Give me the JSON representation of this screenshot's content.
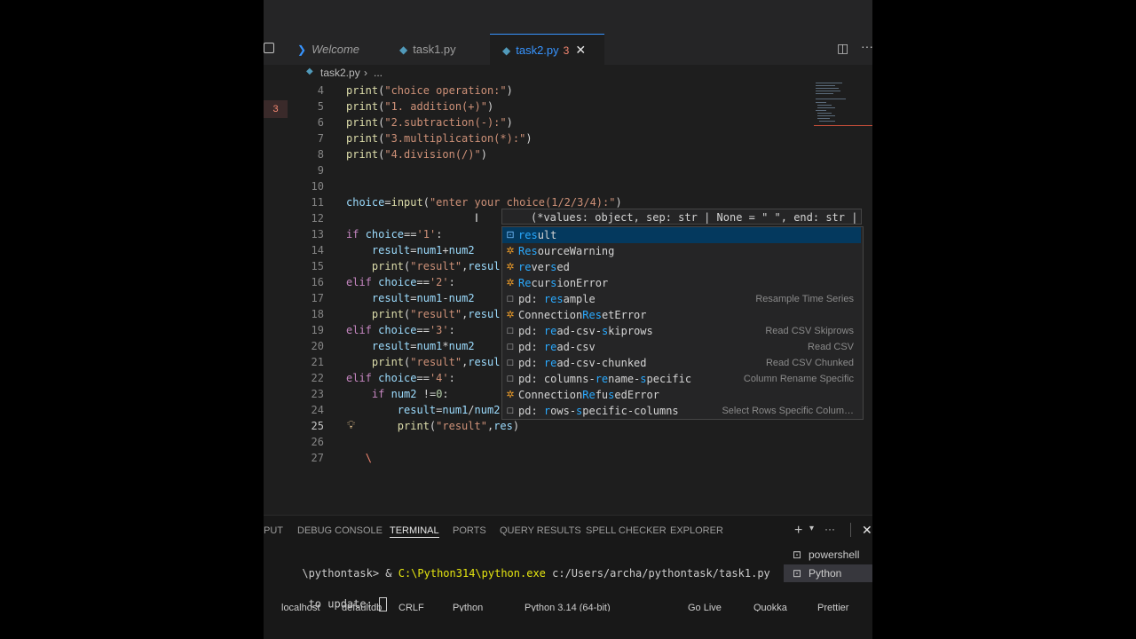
{
  "tabs": [
    {
      "label": "Welcome",
      "icon": "vscode-icon"
    },
    {
      "label": "task1.py",
      "icon": "python-icon"
    },
    {
      "label": "task2.py",
      "badge": "3",
      "icon": "python-icon"
    }
  ],
  "breadcrumb": {
    "file": "task2.py",
    "more": "..."
  },
  "gutter_problem_count": "3",
  "lines": [
    {
      "n": "4",
      "html": "<span class='fn'>print</span>(<span class='str'>\"choice operation:\"</span>)"
    },
    {
      "n": "5",
      "html": "<span class='fn'>print</span>(<span class='str'>\"1. addition(+)\"</span>)"
    },
    {
      "n": "6",
      "html": "<span class='fn'>print</span>(<span class='str'>\"2.subtraction(-):\"</span>)"
    },
    {
      "n": "7",
      "html": "<span class='fn'>print</span>(<span class='str'>\"3.multiplication(*):\"</span>)"
    },
    {
      "n": "8",
      "html": "<span class='fn'>print</span>(<span class='str'>\"4.division(/)\"</span>)"
    },
    {
      "n": "9",
      "html": ""
    },
    {
      "n": "10",
      "html": ""
    },
    {
      "n": "11",
      "html": "<span class='var'>choice</span>=<span class='fn'>input</span>(<span class='str'>\"enter your choice(1/2/3/4):\"</span>)"
    },
    {
      "n": "12",
      "html": ""
    },
    {
      "n": "13",
      "html": "<span class='kw'>if</span> <span class='var'>choice</span>==<span class='str'>'1'</span>:"
    },
    {
      "n": "14",
      "html": "    <span class='var'>result</span>=<span class='var'>num1</span>+<span class='var'>num2</span>"
    },
    {
      "n": "15",
      "html": "    <span class='fn'>print</span>(<span class='str'>\"result\"</span>,<span class='var'>resul</span>"
    },
    {
      "n": "16",
      "html": "<span class='kw'>elif</span> <span class='var'>choice</span>==<span class='str'>'2'</span>:"
    },
    {
      "n": "17",
      "html": "    <span class='var'>result</span>=<span class='var'>num1</span>-<span class='var'>num2</span>"
    },
    {
      "n": "18",
      "html": "    <span class='fn'>print</span>(<span class='str'>\"result\"</span>,<span class='var'>resul</span>"
    },
    {
      "n": "19",
      "html": "<span class='kw'>elif</span> <span class='var'>choice</span>==<span class='str'>'3'</span>:"
    },
    {
      "n": "20",
      "html": "    <span class='var'>result</span>=<span class='var'>num1</span>*<span class='var'>num2</span>"
    },
    {
      "n": "21",
      "html": "    <span class='fn'>print</span>(<span class='str'>\"result\"</span>,<span class='var'>resul</span>"
    },
    {
      "n": "22",
      "html": "<span class='kw'>elif</span> <span class='var'>choice</span>==<span class='str'>'4'</span>:"
    },
    {
      "n": "23",
      "html": "    <span class='kw'>if</span> <span class='var'>num2</span> !=<span class='num'>0</span>:"
    },
    {
      "n": "24",
      "html": "        <span class='var'>result</span>=<span class='var'>num1</span>/<span class='var'>num2</span>"
    },
    {
      "n": "25",
      "html": "        <span class='fn'>print</span>(<span class='str'>\"result\"</span>,<span class='var'>res</span>)"
    },
    {
      "n": "26",
      "html": ""
    },
    {
      "n": "27",
      "html": "   <span style='color:#f48771'>\\</span>"
    }
  ],
  "signature_hint": "(*values: object, sep: str | None = \" \", end: str |",
  "suggestions": [
    {
      "icon": "variable-icon",
      "pre": "",
      "match": "res",
      "post": "ult",
      "detail": ""
    },
    {
      "icon": "class-icon",
      "pre": "",
      "match": "Res",
      "post": "ourceWarning",
      "detail": ""
    },
    {
      "icon": "class-icon",
      "pre": "",
      "match": "re",
      "post": "ver<b>s</b>ed",
      "detail": ""
    },
    {
      "icon": "class-icon",
      "pre": "",
      "match": "Re",
      "post": "cur<b>s</b>ionError",
      "detail": ""
    },
    {
      "icon": "snippet-icon",
      "pre": "pd: ",
      "match": "res",
      "post": "ample",
      "detail": "Resample Time Series"
    },
    {
      "icon": "class-icon",
      "pre": "Connection",
      "match": "Res",
      "post": "etError",
      "detail": ""
    },
    {
      "icon": "snippet-icon",
      "pre": "pd: ",
      "match": "re",
      "post": "ad-csv-<b>s</b>kiprows",
      "detail": "Read CSV Skiprows"
    },
    {
      "icon": "snippet-icon",
      "pre": "pd: ",
      "match": "re",
      "post": "ad-csv",
      "detail": "Read CSV"
    },
    {
      "icon": "snippet-icon",
      "pre": "pd: ",
      "match": "re",
      "post": "ad-csv-chunked",
      "detail": "Read CSV Chunked"
    },
    {
      "icon": "snippet-icon",
      "pre": "pd: columns-",
      "match": "re",
      "post": "name-<b>s</b>pecific",
      "detail": "Column Rename Specific"
    },
    {
      "icon": "class-icon",
      "pre": "Connection",
      "match": "Re",
      "post": "fu<b>s</b>edError",
      "detail": ""
    },
    {
      "icon": "snippet-icon",
      "pre": "pd: ",
      "match": "r",
      "post": "ows-<b>s</b>pecific-columns",
      "detail": "Select Rows Specific Colum…"
    }
  ],
  "panel_tabs": [
    "PUT",
    "DEBUG CONSOLE",
    "TERMINAL",
    "PORTS",
    "QUERY RESULTS",
    "SPELL CHECKER",
    "EXPLORER"
  ],
  "terminal": {
    "line1_prefix": "\\pythontask> & ",
    "line1_exe": "C:\\Python314\\python.exe",
    "line1_arg": " c:/Users/archa/pythontask/task1.py",
    "line2": " to update: "
  },
  "terminal_list": [
    "powershell",
    "Python"
  ],
  "status_items": [
    "localhost",
    "defaultdb",
    "CRLF",
    "Python",
    "Python 3.14 (64-bit)",
    "Go Live",
    "Quokka",
    "Prettier"
  ],
  "colors": {
    "accent": "#3794ff",
    "background": "#1e1e1e",
    "selection": "#04395e"
  }
}
